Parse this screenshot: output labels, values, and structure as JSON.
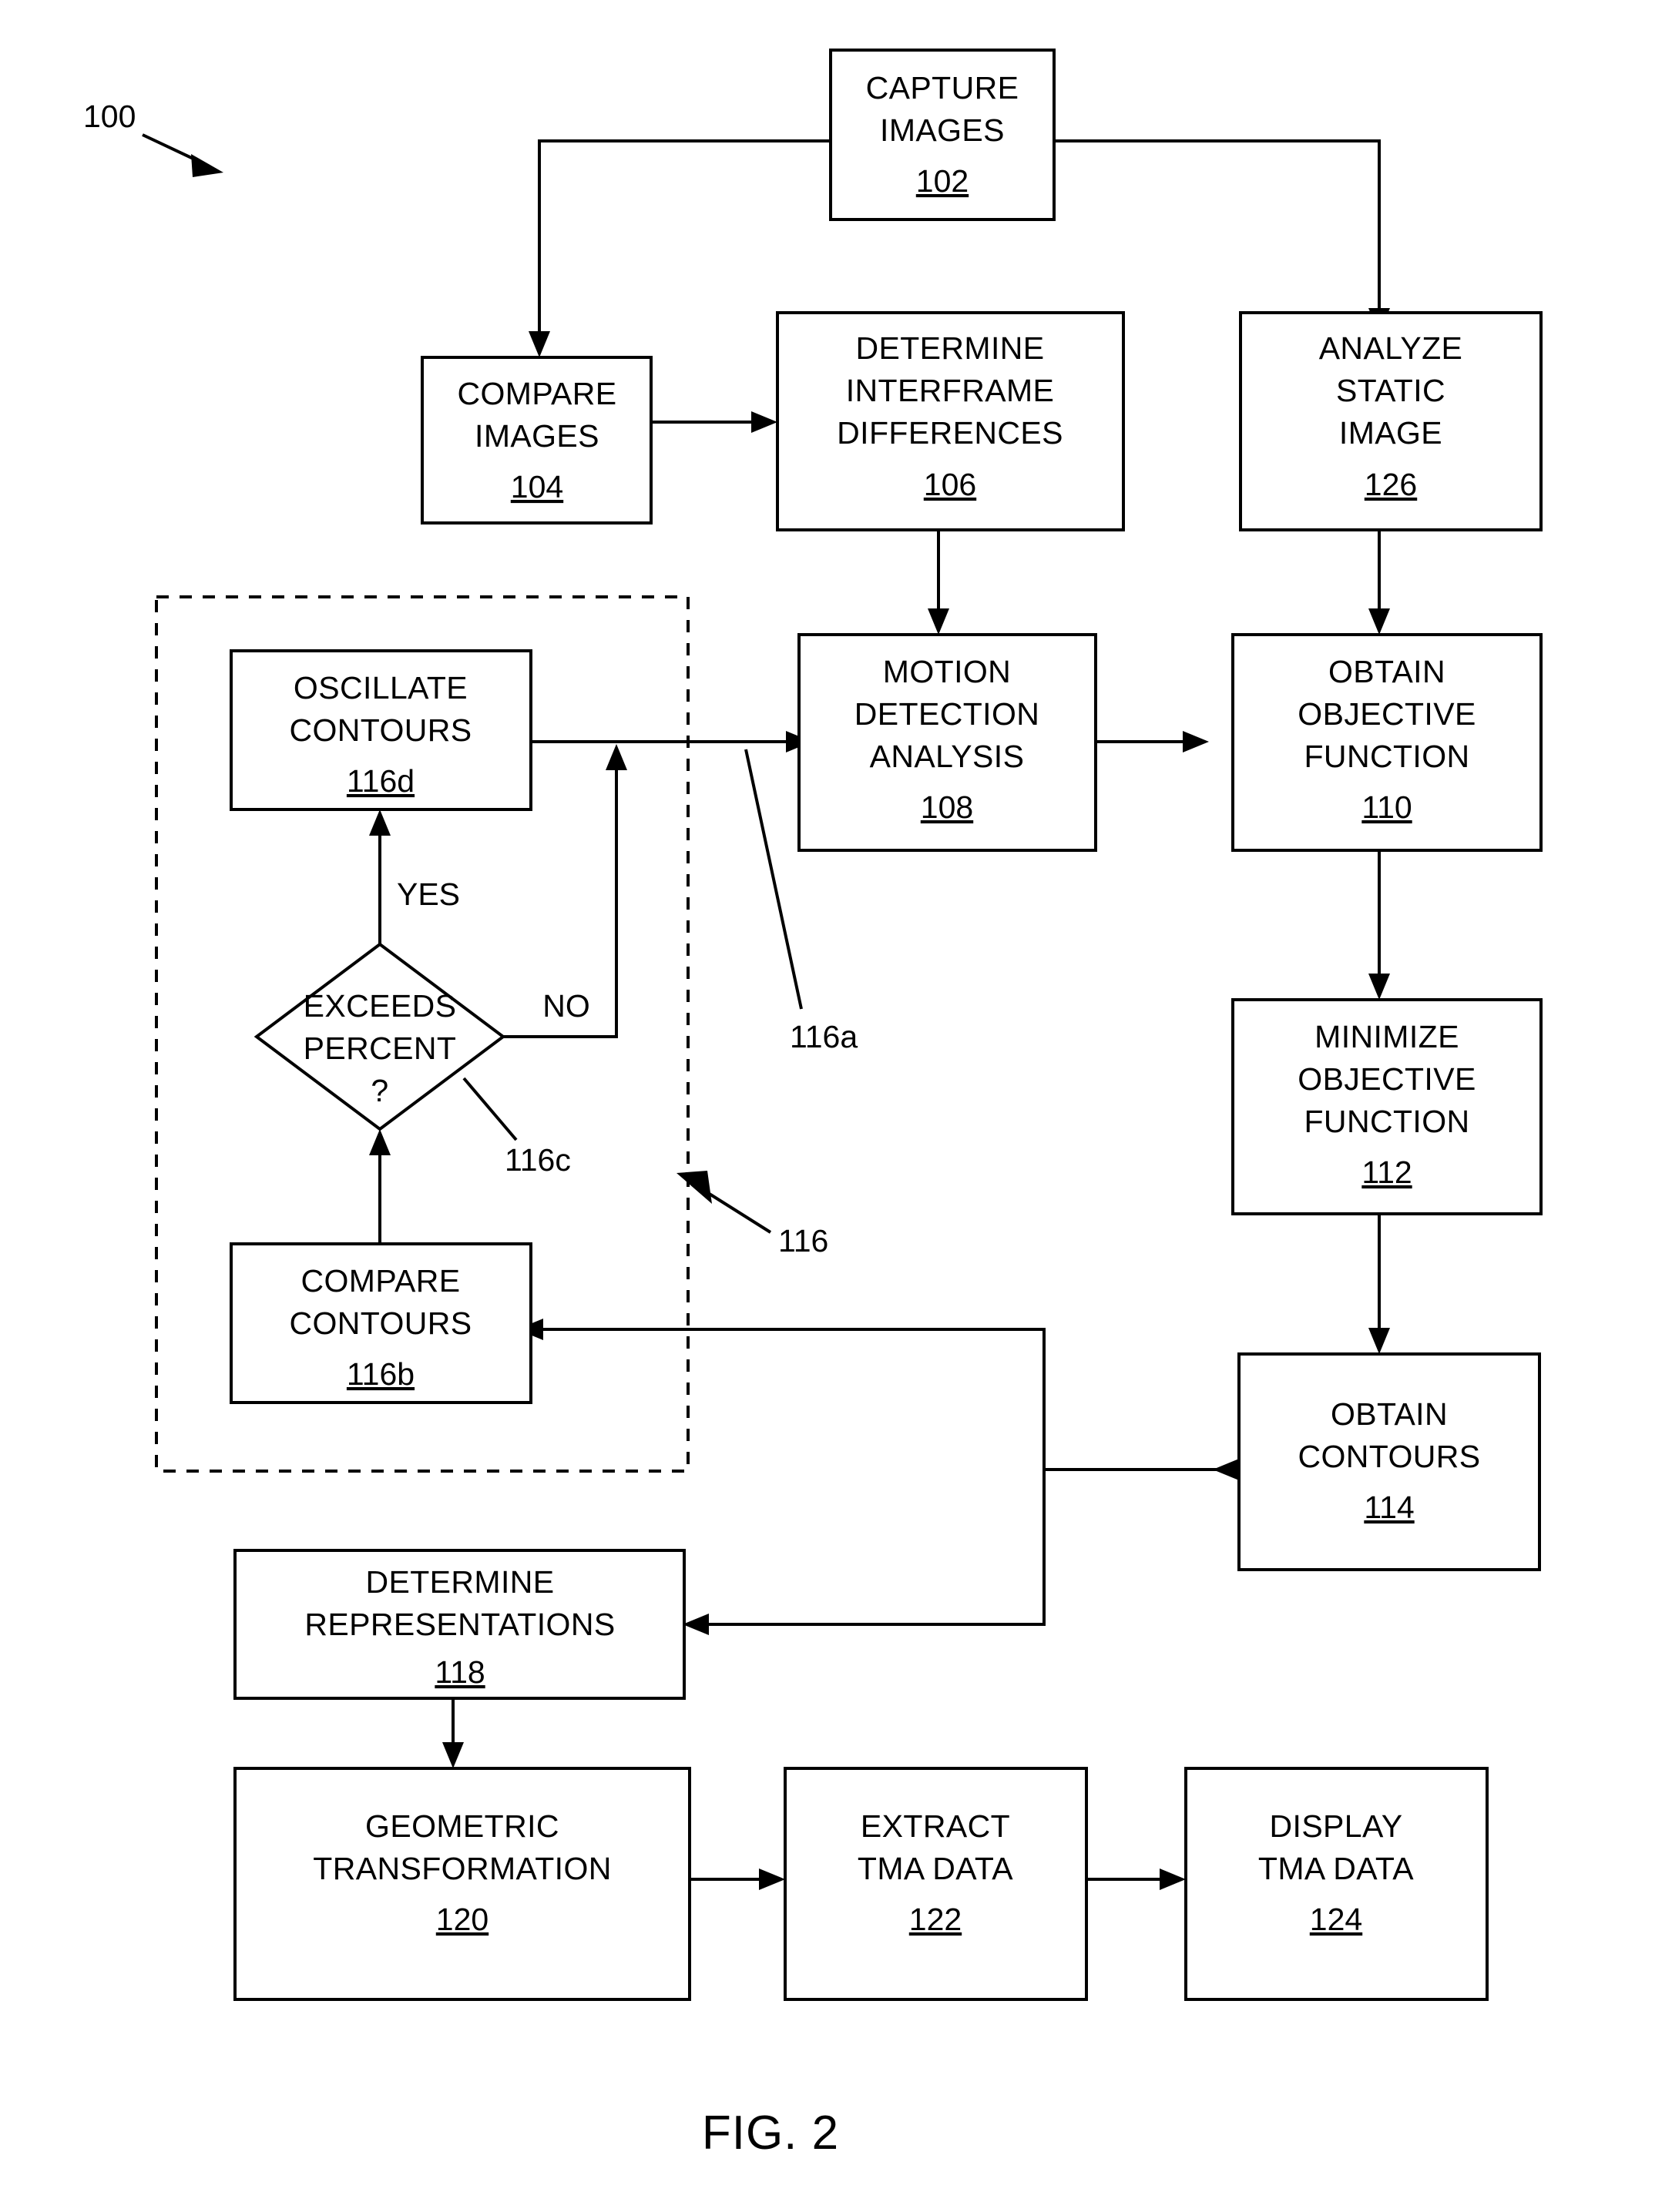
{
  "figure": {
    "caption": "FIG. 2",
    "reference_numeral": "100"
  },
  "nodes": [
    {
      "id": "capture_images",
      "name": "capture-images",
      "lines": [
        "CAPTURE",
        "IMAGES"
      ],
      "number": "102",
      "shape": "rect"
    },
    {
      "id": "compare_images",
      "name": "compare-images",
      "lines": [
        "COMPARE",
        "IMAGES"
      ],
      "number": "104",
      "shape": "rect"
    },
    {
      "id": "determine_interframe_differences",
      "name": "determine-interframe-differences",
      "lines": [
        "DETERMINE",
        "INTERFRAME",
        "DIFFERENCES"
      ],
      "number": "106",
      "shape": "rect"
    },
    {
      "id": "analyze_static_image",
      "name": "analyze-static-image",
      "lines": [
        "ANALYZE",
        "STATIC",
        "IMAGE"
      ],
      "number": "126",
      "shape": "rect"
    },
    {
      "id": "oscillate_contours",
      "name": "oscillate-contours",
      "lines": [
        "OSCILLATE",
        "CONTOURS"
      ],
      "number": "116d",
      "shape": "rect"
    },
    {
      "id": "motion_detection_analysis",
      "name": "motion-detection-analysis",
      "lines": [
        "MOTION",
        "DETECTION",
        "ANALYSIS"
      ],
      "number": "108",
      "shape": "rect"
    },
    {
      "id": "obtain_objective_function",
      "name": "obtain-objective-function",
      "lines": [
        "OBTAIN",
        "OBJECTIVE",
        "FUNCTION"
      ],
      "number": "110",
      "shape": "rect"
    },
    {
      "id": "exceeds_percent",
      "name": "exceeds-percent-decision",
      "lines": [
        "EXCEEDS",
        "PERCENT",
        "?"
      ],
      "number": "",
      "shape": "diamond"
    },
    {
      "id": "minimize_objective_function",
      "name": "minimize-objective-function",
      "lines": [
        "MINIMIZE",
        "OBJECTIVE",
        "FUNCTION"
      ],
      "number": "112",
      "shape": "rect"
    },
    {
      "id": "compare_contours",
      "name": "compare-contours",
      "lines": [
        "COMPARE",
        "CONTOURS"
      ],
      "number": "116b",
      "shape": "rect"
    },
    {
      "id": "obtain_contours",
      "name": "obtain-contours",
      "lines": [
        "OBTAIN",
        "CONTOURS"
      ],
      "number": "114",
      "shape": "rect"
    },
    {
      "id": "determine_representations",
      "name": "determine-representations",
      "lines": [
        "DETERMINE",
        "REPRESENTATIONS"
      ],
      "number": "118",
      "shape": "rect"
    },
    {
      "id": "geometric_transformation",
      "name": "geometric-transformation",
      "lines": [
        "GEOMETRIC",
        "TRANSFORMATION"
      ],
      "number": "120",
      "shape": "rect"
    },
    {
      "id": "extract_tma_data",
      "name": "extract-tma-data",
      "lines": [
        "EXTRACT",
        "TMA DATA"
      ],
      "number": "122",
      "shape": "rect"
    },
    {
      "id": "display_tma_data",
      "name": "display-tma-data",
      "lines": [
        "DISPLAY",
        "TMA DATA"
      ],
      "number": "124",
      "shape": "rect"
    }
  ],
  "edge_labels": {
    "yes": "YES",
    "no": "NO"
  },
  "reference_callouts": {
    "group_116": "116",
    "branch_116a": "116a",
    "decision_116c": "116c"
  },
  "colors": {
    "ink": "#000000",
    "paper": "#ffffff"
  }
}
